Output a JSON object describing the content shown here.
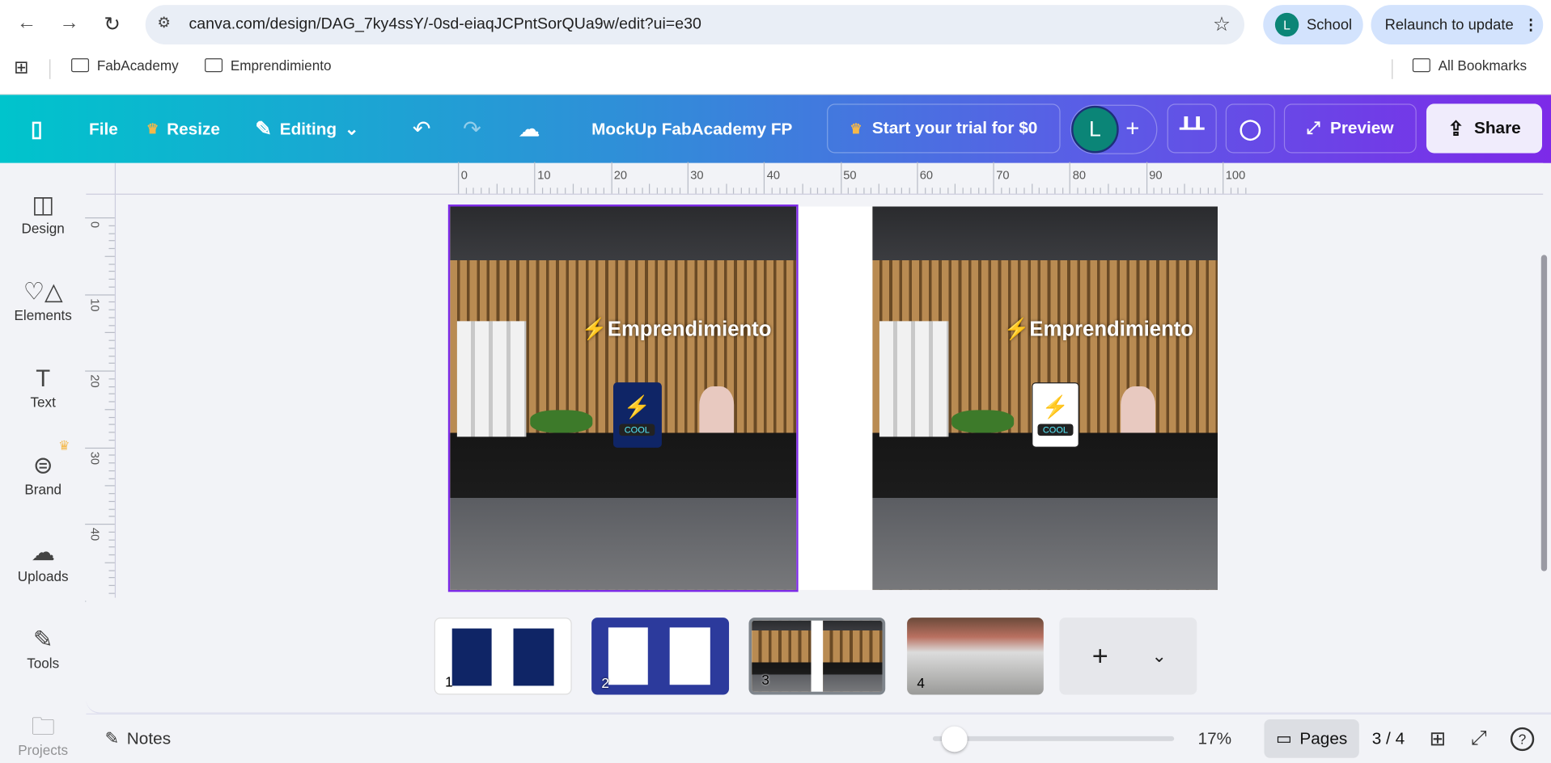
{
  "browser": {
    "url": "canva.com/design/DAG_7ky4ssY/-0sd-eiaqJCPntSorQUa9w/edit?ui=e30",
    "profile_initial": "L",
    "profile_label": "School",
    "relaunch_label": "Relaunch to update",
    "bookmarks": [
      "FabAcademy",
      "Emprendimiento"
    ],
    "all_bookmarks": "All Bookmarks"
  },
  "toolbar": {
    "file": "File",
    "resize": "Resize",
    "editing": "Editing",
    "title": "MockUp FabAcademy FP",
    "trial": "Start your trial for $0",
    "avatar": "L",
    "preview": "Preview",
    "share": "Share",
    "gradient": [
      "#00c4cc",
      "#7d2ae8"
    ]
  },
  "sidebar": {
    "items": [
      {
        "label": "Design",
        "icon": "design-icon"
      },
      {
        "label": "Elements",
        "icon": "elements-icon"
      },
      {
        "label": "Text",
        "icon": "text-icon"
      },
      {
        "label": "Brand",
        "icon": "brand-icon"
      },
      {
        "label": "Uploads",
        "icon": "uploads-icon"
      },
      {
        "label": "Tools",
        "icon": "tools-icon"
      },
      {
        "label": "Projects",
        "icon": "folder-icon"
      }
    ]
  },
  "ruler": {
    "top": [
      "0",
      "10",
      "20",
      "30",
      "40",
      "50",
      "60",
      "70",
      "80",
      "90",
      "100"
    ],
    "left": [
      "0",
      "10",
      "20",
      "30",
      "40"
    ]
  },
  "canvas": {
    "photo_title": "Emprendimiento",
    "card_label": "COOL",
    "selection_color": "#7d2ae8"
  },
  "pages": {
    "thumbnails": [
      "1",
      "2",
      "3",
      "4"
    ],
    "current": 3
  },
  "footer": {
    "notes": "Notes",
    "zoom": "17%",
    "zoom_percent": 17,
    "pages": "Pages",
    "page_indicator": "3 / 4"
  }
}
